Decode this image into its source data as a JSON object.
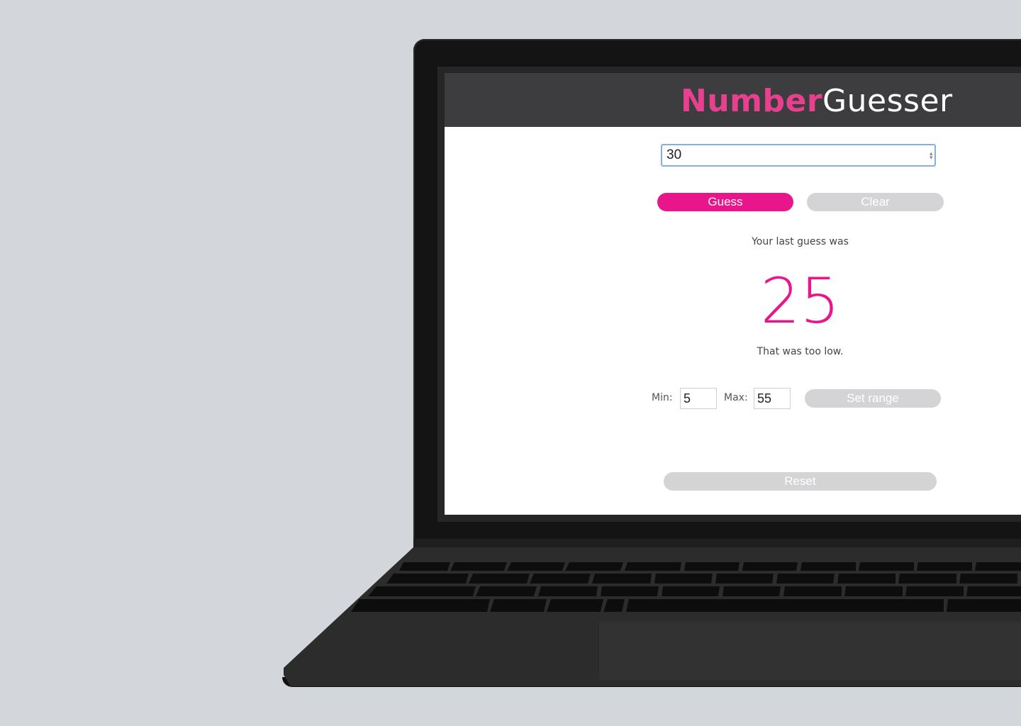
{
  "app": {
    "logo_part1": "Number",
    "logo_part2": "Guesser"
  },
  "guess_input": {
    "value": "30"
  },
  "buttons": {
    "guess": "Guess",
    "clear": "Clear",
    "set_range": "Set range",
    "reset": "Reset"
  },
  "result": {
    "intro": "Your last guess was",
    "number": "25",
    "feedback": "That was too low."
  },
  "range": {
    "min_label": "Min:",
    "min_value": "5",
    "max_label": "Max:",
    "max_value": "55"
  },
  "colors": {
    "accent": "#e8168a",
    "header": "#3d3d3f",
    "disabled": "#d4d4d6"
  },
  "icons": [
    "spinner-arrows-icon"
  ]
}
